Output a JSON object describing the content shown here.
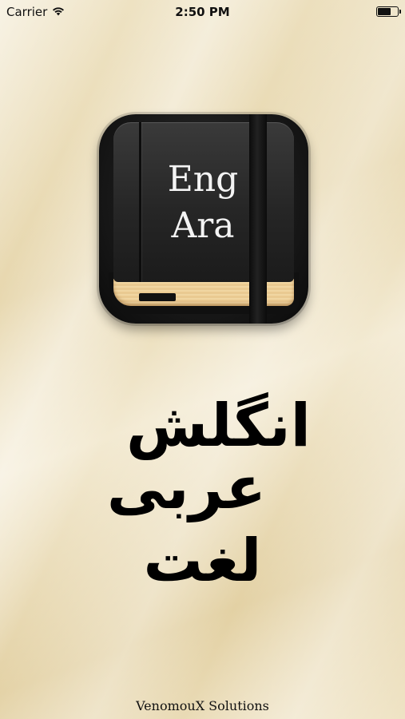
{
  "status_bar": {
    "carrier": "Carrier",
    "time": "2:50 PM",
    "battery_level": 0.6,
    "wifi_icon": "wifi-icon",
    "battery_icon": "battery-icon"
  },
  "app_icon": {
    "line1": "Eng",
    "line2": "Ara",
    "icon": "dictionary-book-icon"
  },
  "title": {
    "line1": "انگلش",
    "line2": "عربی",
    "line3": "لغت"
  },
  "footer": {
    "credit": "VenomouX Solutions"
  }
}
